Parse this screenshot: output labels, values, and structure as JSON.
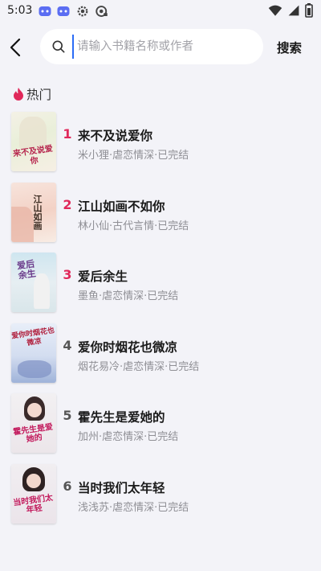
{
  "status_bar": {
    "time": "5:03",
    "left_icons": [
      "gamepad-icon",
      "gamepad-icon",
      "gear-icon",
      "assistant-icon"
    ],
    "right_icons": [
      "wifi-icon",
      "signal-icon",
      "battery-icon"
    ]
  },
  "header": {
    "search_placeholder": "请输入书籍名称或作者",
    "search_value": "",
    "search_button_label": "搜索"
  },
  "hot_section": {
    "title": "热门",
    "icon": "flame-icon",
    "accent_color": "#e0285a",
    "books": [
      {
        "rank": "1",
        "title": "来不及说爱你",
        "meta": "米小狸·虐恋情深·已完结",
        "cover_text": "来不及说爱你"
      },
      {
        "rank": "2",
        "title": "江山如画不如你",
        "meta": "林小仙·古代言情·已完结",
        "cover_text": "江山如画"
      },
      {
        "rank": "3",
        "title": "爱后余生",
        "meta": "墨鱼·虐恋情深·已完结",
        "cover_text": "爱后余生"
      },
      {
        "rank": "4",
        "title": "爱你时烟花也微凉",
        "meta": "烟花易冷·虐恋情深·已完结",
        "cover_text": "爱你时烟花也微凉"
      },
      {
        "rank": "5",
        "title": "霍先生是爱她的",
        "meta": "加州·虐恋情深·已完结",
        "cover_text": "霍先生是爱她的"
      },
      {
        "rank": "6",
        "title": "当时我们太年轻",
        "meta": "浅浅苏·虐恋情深·已完结",
        "cover_text": "当时我们太年轻"
      }
    ]
  }
}
